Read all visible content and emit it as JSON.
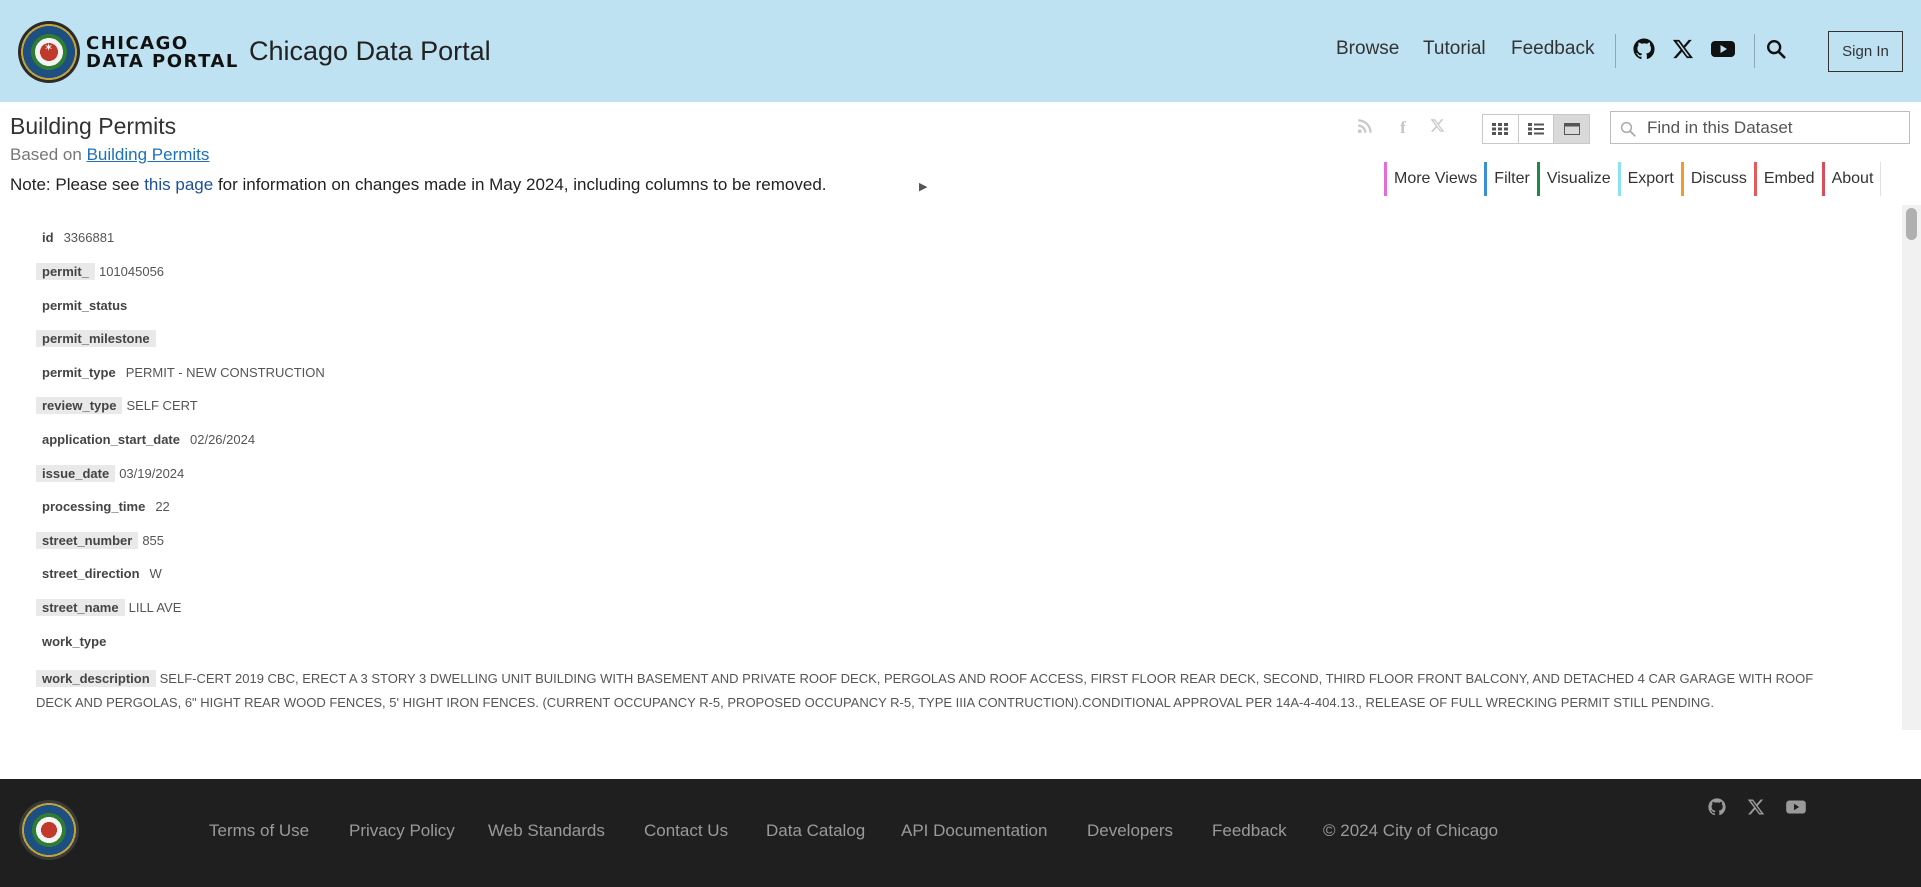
{
  "header": {
    "logo_line1": "CHICAGO",
    "logo_line2": "DATA PORTAL",
    "site_title": "Chicago Data Portal",
    "nav": {
      "browse": "Browse",
      "tutorial": "Tutorial",
      "feedback": "Feedback"
    },
    "icons": [
      "github-icon",
      "x-icon",
      "youtube-icon",
      "search-icon"
    ],
    "sign_in": "Sign In"
  },
  "dataset": {
    "title": "Building Permits",
    "based_on_prefix": "Based on",
    "based_on_link": "Building Permits",
    "note_prefix": "Note: Please see",
    "note_link": "this page",
    "note_suffix": "for information on changes made in May 2024, including columns to be removed.",
    "search_placeholder": "Find in this Dataset",
    "share_icons": [
      "rss-icon",
      "facebook-icon",
      "x-icon"
    ],
    "view_toggle_icons": [
      "grid-view-icon",
      "list-view-icon",
      "single-row-view-icon"
    ]
  },
  "actions": [
    {
      "label": "More Views",
      "color": "#e86ad8"
    },
    {
      "label": "Filter",
      "color": "#3a8fd6"
    },
    {
      "label": "Visualize",
      "color": "#1a8a4a"
    },
    {
      "label": "Export",
      "color": "#8de1f5"
    },
    {
      "label": "Discuss",
      "color": "#f29b2b"
    },
    {
      "label": "Embed",
      "color": "#e85a5a"
    },
    {
      "label": "About",
      "color": "#d94c5a"
    }
  ],
  "record": {
    "fields": [
      {
        "label": "id",
        "value": "3366881"
      },
      {
        "label": "permit_",
        "value": "101045056"
      },
      {
        "label": "permit_status",
        "value": ""
      },
      {
        "label": "permit_milestone",
        "value": ""
      },
      {
        "label": "permit_type",
        "value": "PERMIT - NEW CONSTRUCTION"
      },
      {
        "label": "review_type",
        "value": "SELF CERT"
      },
      {
        "label": "application_start_date",
        "value": "02/26/2024"
      },
      {
        "label": "issue_date",
        "value": "03/19/2024"
      },
      {
        "label": "processing_time",
        "value": "22"
      },
      {
        "label": "street_number",
        "value": "855"
      },
      {
        "label": "street_direction",
        "value": "W"
      },
      {
        "label": "street_name",
        "value": "LILL AVE"
      },
      {
        "label": "work_type",
        "value": ""
      }
    ],
    "work_description_label": "work_description",
    "work_description": "SELF-CERT 2019 CBC, ERECT A 3 STORY 3 DWELLING UNIT BUILDING WITH BASEMENT AND PRIVATE ROOF DECK, PERGOLAS AND ROOF ACCESS, FIRST FLOOR REAR DECK, SECOND, THIRD FLOOR FRONT BALCONY, AND DETACHED 4 CAR GARAGE WITH ROOF DECK AND PERGOLAS, 6\" HIGHT REAR WOOD FENCES, 5' HIGHT IRON FENCES. (CURRENT OCCUPANCY R-5, PROPOSED OCCUPANCY R-5, TYPE IIIA CONTRUCTION).CONDITIONAL APPROVAL PER 14A-4-404.13., RELEASE OF FULL WRECKING PERMIT STILL PENDING."
  },
  "footer": {
    "links": [
      "Terms of Use",
      "Privacy Policy",
      "Web Standards",
      "Contact Us",
      "Data Catalog",
      "API Documentation",
      "Developers",
      "Feedback",
      "© 2024 City of Chicago"
    ],
    "icons": [
      "github-icon",
      "x-icon",
      "youtube-icon"
    ]
  }
}
